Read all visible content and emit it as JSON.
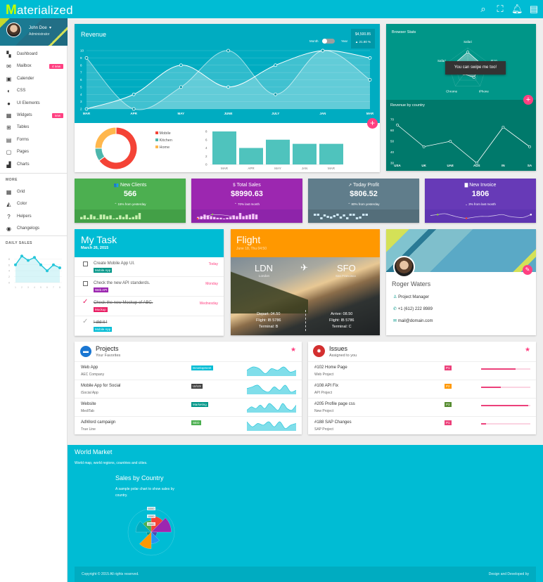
{
  "app": {
    "logo_first": "M",
    "logo_rest": "aterialized"
  },
  "header_icons": [
    "search-icon",
    "fullscreen-icon",
    "bell-icon",
    "chat-icon"
  ],
  "user": {
    "name": "John Doe",
    "role": "Administrator"
  },
  "sidebar": {
    "items": [
      {
        "label": "Dashboard",
        "icon": "dashboard-icon",
        "glyph": "▚"
      },
      {
        "label": "Mailbox",
        "icon": "mail-icon",
        "glyph": "✉",
        "badge": "4 new"
      },
      {
        "label": "Calender",
        "icon": "calendar-icon",
        "glyph": "▣"
      },
      {
        "label": "CSS",
        "icon": "contrast-icon",
        "glyph": "◐"
      },
      {
        "label": "UI Elements",
        "icon": "palette-icon",
        "glyph": "●"
      },
      {
        "label": "Widgets",
        "icon": "widgets-icon",
        "glyph": "▦",
        "badge": "new"
      },
      {
        "label": "Tables",
        "icon": "table-icon",
        "glyph": "⊞"
      },
      {
        "label": "Forms",
        "icon": "form-icon",
        "glyph": "▤"
      },
      {
        "label": "Pages",
        "icon": "pages-icon",
        "glyph": "▢"
      },
      {
        "label": "Charts",
        "icon": "chart-icon",
        "glyph": "▟"
      }
    ],
    "more_heading": "MORE",
    "more_items": [
      {
        "label": "Grid",
        "icon": "grid-icon",
        "glyph": "▦"
      },
      {
        "label": "Color",
        "icon": "color-fill-icon",
        "glyph": "◭"
      },
      {
        "label": "Helpers",
        "icon": "help-icon",
        "glyph": "?"
      },
      {
        "label": "Changelogs",
        "icon": "globe-icon",
        "glyph": "◉"
      }
    ],
    "daily_sales": {
      "heading": "DAILY SALES",
      "x": [
        1,
        2,
        3,
        4,
        5,
        6,
        7,
        8
      ],
      "y": [
        6,
        9,
        7.5,
        8.5,
        6,
        4,
        6,
        5
      ],
      "yticks": [
        0,
        2,
        4,
        6,
        8
      ],
      "ylim": [
        0,
        10
      ]
    }
  },
  "revenue": {
    "title": "Revenue",
    "toggle_left": "Month",
    "toggle_right": "Year",
    "amount": "$4,500.85",
    "change": "21.80 %",
    "chart_data": {
      "type": "area",
      "categories": [
        "MAR",
        "APR",
        "MAY",
        "JUNE",
        "JULY",
        "JAN",
        "MAR"
      ],
      "series": [
        {
          "values": [
            2,
            4,
            8,
            5,
            8,
            10,
            9
          ]
        },
        {
          "values": [
            9,
            2,
            5,
            10,
            4,
            10,
            6
          ]
        }
      ],
      "yticks": [
        2,
        3,
        4,
        5,
        6,
        7,
        8,
        9,
        10
      ],
      "ylim": [
        2,
        10
      ]
    },
    "donut": {
      "type": "pie",
      "labels": [
        "Mobile",
        "Kitchen",
        "Home"
      ],
      "values": [
        65,
        10,
        25
      ],
      "colors": [
        "#f44336",
        "#4db6ac",
        "#ffb74d"
      ]
    },
    "bars": {
      "type": "bar",
      "categories": [
        "MAR",
        "APR",
        "MAY",
        "JAN",
        "MAR"
      ],
      "values": [
        8,
        4,
        6,
        5,
        5
      ],
      "yticks": [
        0,
        2,
        4,
        6,
        8
      ],
      "ylim": [
        0,
        8
      ],
      "color": "#4fc3bd"
    }
  },
  "browser_stats": {
    "title": "Browser Stats",
    "labels": [
      "Safari",
      "IE10",
      "iPhone",
      "Chrome",
      "Safari"
    ],
    "values": [
      8,
      7,
      5,
      3,
      7
    ],
    "tooltip": "You can swipe me too!"
  },
  "revenue_country": {
    "title": "Revenue by country",
    "chart_data": {
      "type": "line",
      "categories": [
        "USA",
        "UK",
        "UAE",
        "AUS",
        "IN",
        "SA"
      ],
      "values": [
        65,
        45,
        50,
        30,
        63,
        45
      ],
      "yticks": [
        30,
        40,
        50,
        60,
        70
      ],
      "ylim": [
        30,
        70
      ]
    }
  },
  "stats": [
    {
      "title": "New Clients",
      "icon": "users-icon",
      "glyph": "👥",
      "value": "566",
      "sub": "15% from yesterday",
      "dir": "up",
      "color": "#4caf50",
      "dark": "#43a047",
      "spark": [
        3,
        5,
        2,
        6,
        4,
        1,
        6,
        6,
        4,
        5,
        1,
        2,
        5,
        3,
        6,
        2,
        3,
        5,
        8
      ],
      "spark_color": "#c8f0b0"
    },
    {
      "title": "Total Sales",
      "icon": "dollar-icon",
      "glyph": "$",
      "value": "$8990.63",
      "sub": "70% last month",
      "dir": "up",
      "color": "#9c27b0",
      "dark": "#8e24aa",
      "spark": [
        3,
        4,
        6,
        5,
        4,
        3,
        2,
        2,
        1,
        2,
        3,
        5,
        4,
        8,
        4,
        5,
        6,
        7,
        6
      ],
      "spark_color": "#f3c6f7"
    },
    {
      "title": "Today Profit",
      "icon": "trending-up-icon",
      "glyph": "↗",
      "value": "$806.52",
      "sub": "80% from yesterday",
      "dir": "up",
      "color": "#607d8b",
      "dark": "#546e7a",
      "spark": [
        5,
        5,
        0,
        4,
        2,
        1,
        3,
        5,
        1,
        4,
        0,
        5,
        5,
        0,
        1,
        5,
        5
      ],
      "spark_color": "#cfe8f5"
    },
    {
      "title": "New Invoice",
      "icon": "invoice-icon",
      "glyph": "▇",
      "value": "1806",
      "sub": "3% from last month",
      "dir": "down",
      "color": "#673ab7",
      "dark": "#5e35b1",
      "spark": [
        5,
        6,
        7,
        5,
        3,
        2,
        3,
        4,
        4,
        5,
        6,
        4,
        3,
        3,
        6
      ],
      "spark_color": "#d1c4e9"
    }
  ],
  "tasks": {
    "title": "My Task",
    "date": "March 26, 2015",
    "items": [
      {
        "text": "Create Mobile App UI.",
        "tag": "Mobile App",
        "tag_color": "#009688",
        "day": "Today",
        "done": false
      },
      {
        "text": "Check the new API standerds.",
        "tag": "Web API",
        "tag_color": "#9c27b0",
        "day": "Monday",
        "done": false
      },
      {
        "text": "Check the new Mockup of ABC.",
        "tag": "Mockup",
        "tag_color": "#e91e63",
        "day": "Wednesday",
        "done": true
      },
      {
        "text": "I did it !",
        "tag": "Mobile App",
        "tag_color": "#00bcd4",
        "day": "",
        "done": true
      }
    ]
  },
  "flight": {
    "title": "Flight",
    "date": "June 18, Thu 04:50",
    "from": "LDN",
    "from_city": "London",
    "to": "SFO",
    "to_city": "San Francisco",
    "depart": "Depart: 04.50",
    "flight1": "Flight: IB 5786",
    "terminal1": "Terminal: B",
    "arrive": "Arrive: 08.50",
    "flight2": "Flight: IB 5786",
    "terminal2": "Terminal: C"
  },
  "profile": {
    "name": "Roger Waters",
    "job": "Project Manager",
    "phone": "+1 (612) 222 8989",
    "email": "mail@domain.com"
  },
  "projects": {
    "title": "Projects",
    "subtitle": "Your Favorites",
    "items": [
      {
        "name": "Web App",
        "company": "AEC Company",
        "tag": "Development",
        "tag_color": "#00bcd4",
        "spark": [
          3,
          5,
          4,
          1,
          4,
          3,
          5,
          2,
          3
        ]
      },
      {
        "name": "Mobile App for Social",
        "company": "iSocial App",
        "tag": "UI/UX",
        "tag_color": "#424242",
        "spark": [
          3,
          4,
          5,
          2,
          1,
          4,
          2,
          5,
          1,
          2
        ]
      },
      {
        "name": "Website",
        "company": "MediTab",
        "tag": "Marketing",
        "tag_color": "#009688",
        "spark": [
          1,
          3,
          2,
          4,
          2,
          5,
          3,
          1,
          5,
          2,
          1,
          4
        ]
      },
      {
        "name": "AdWord campaign",
        "company": "True Line",
        "tag": "SEO",
        "tag_color": "#4caf50",
        "spark": [
          5,
          2,
          4,
          3,
          5,
          2,
          5,
          1,
          3,
          4
        ]
      }
    ]
  },
  "issues": {
    "title": "Issues",
    "subtitle": "Assigned to you",
    "items": [
      {
        "name": "#102 Home Page",
        "project": "Web Project",
        "priority": "P1",
        "color": "#ec407a",
        "progress": 70
      },
      {
        "name": "#108 API Fix",
        "project": "API Project",
        "priority": "P2",
        "color": "#ff9800",
        "progress": 40
      },
      {
        "name": "#205 Profile page css",
        "project": "New Project",
        "priority": "P3",
        "color": "#558b2f",
        "progress": 95
      },
      {
        "name": "#188 SAP Changes",
        "project": "SAP Project",
        "priority": "P1",
        "color": "#ec407a",
        "progress": 10
      }
    ]
  },
  "world": {
    "title": "World Market",
    "subtitle": "World map, world regions, countries and cities.",
    "chart_title": "Sales by Country",
    "chart_desc": "A sample polar chart to show sales by country.",
    "polar": {
      "type": "polar",
      "ticks": [
        "6000",
        "4000",
        "2000"
      ],
      "values": [
        4200,
        5200,
        1500,
        3000,
        4300,
        1200,
        4000,
        3000
      ],
      "colors": [
        "#f44336",
        "#9c27b0",
        "#3f51b5",
        "#2196f3",
        "#ff9800",
        "#009688",
        "#00acc1",
        "#4caf50"
      ]
    }
  },
  "footer": {
    "copyright": "Copyright © 2015 All rights reserved.",
    "credit": "Design and Developed by"
  }
}
